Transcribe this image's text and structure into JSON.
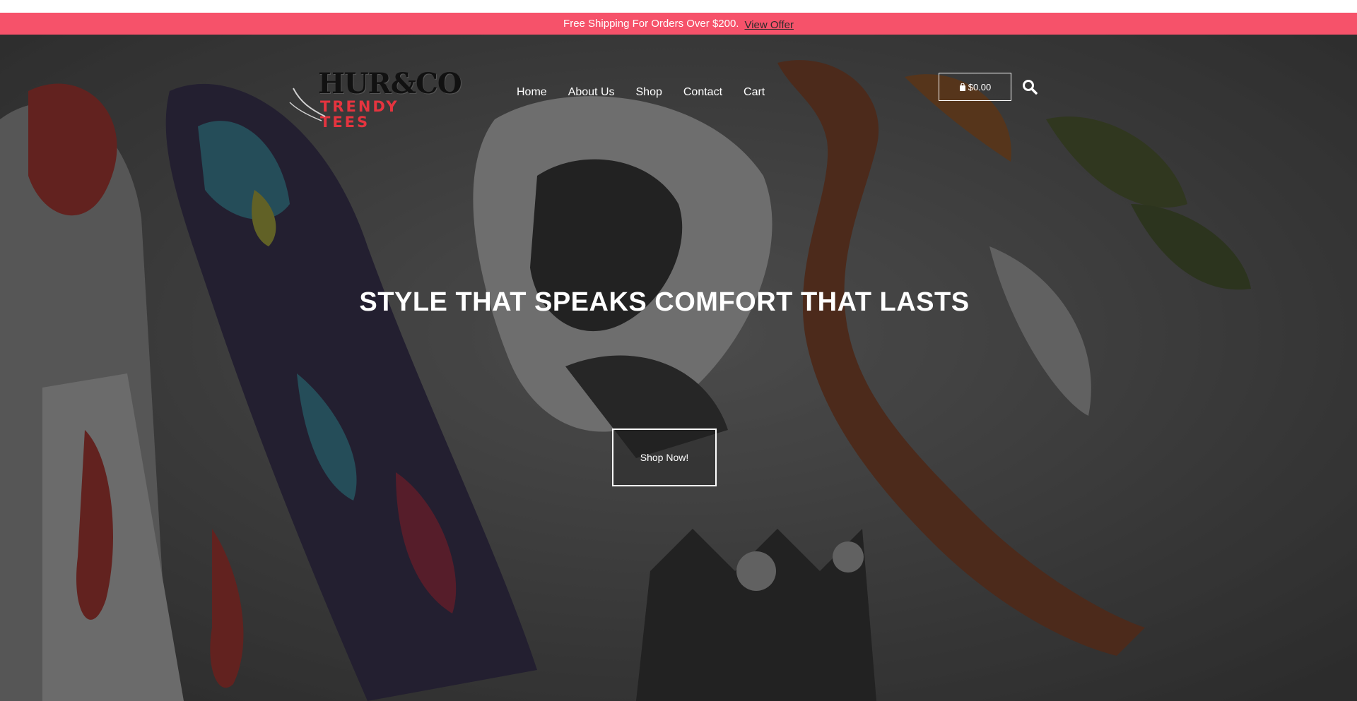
{
  "promo": {
    "text": "Free Shipping For Orders Over $200.",
    "link_label": "View Offer",
    "background": "#f6526a"
  },
  "brand": {
    "logo_line1": "HUR&CO",
    "logo_line2": "TRENDY TEES"
  },
  "nav": {
    "items": [
      {
        "label": "Home"
      },
      {
        "label": "About Us"
      },
      {
        "label": "Shop"
      },
      {
        "label": "Contact"
      },
      {
        "label": "Cart"
      }
    ]
  },
  "header": {
    "cart_total": "$0.00",
    "cart_icon": "shopping-bag-icon",
    "search_icon": "search-icon"
  },
  "hero": {
    "headline": "STYLE THAT SPEAKS COMFORT THAT LASTS",
    "cta_label": "Shop Now!"
  }
}
